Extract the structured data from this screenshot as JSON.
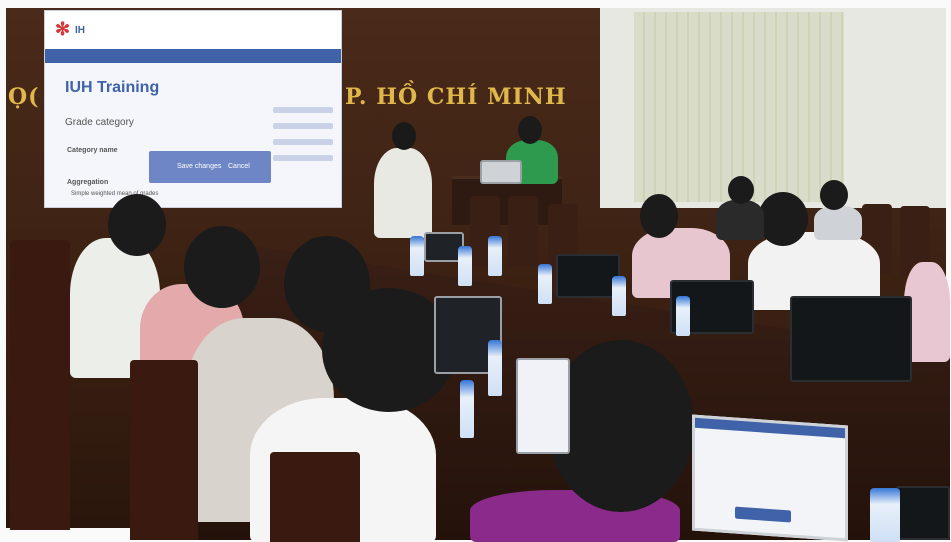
{
  "wall": {
    "text_left": "Ọ(",
    "text_right": "P. HỒ CHÍ MINH"
  },
  "projection": {
    "logo_text": "IH",
    "title": "IUH Training",
    "section": "Grade category",
    "category_label": "Category name",
    "aggregation_label": "Aggregation",
    "aggregation_value": "Simple weighted mean of grades",
    "save_button": "Save changes",
    "cancel_button": "Cancel"
  },
  "colors": {
    "wall": "#3a2012",
    "lettering": "#e0b84a",
    "moodle_blue": "#3f62a8"
  }
}
